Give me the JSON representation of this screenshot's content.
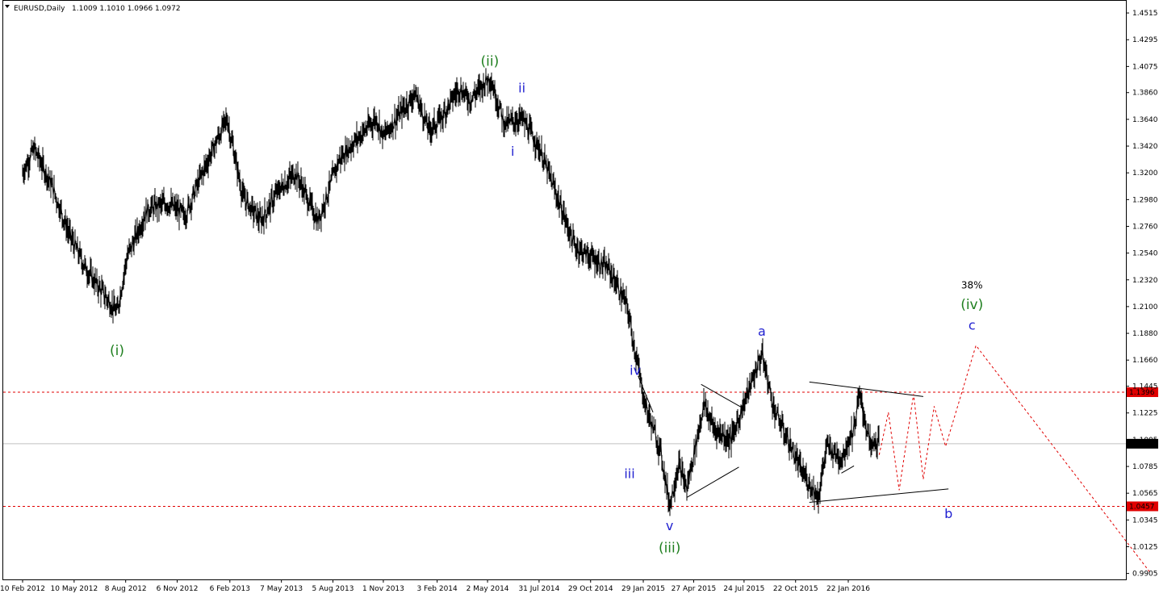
{
  "header": {
    "symbol": "EURUSD,Daily",
    "ohlc": "1.1009 1.1010 1.0966 1.0972"
  },
  "colors": {
    "wave_major": "#1f7f1f",
    "wave_minor": "#1f1fd0",
    "level_line": "#e00000",
    "level_box": "#e00000",
    "price_line": "#c0c0c0",
    "price_box": "#000000",
    "projection": "#e00000",
    "candles": "#000000",
    "pct_label": "#000000"
  },
  "chart_data": {
    "type": "line",
    "title": "",
    "symbol": "EURUSD",
    "timeframe": "Daily",
    "ylim": [
      0.9856,
      1.4615
    ],
    "y_ticks": [
      "1.4515",
      "1.4295",
      "1.4075",
      "1.3860",
      "1.3640",
      "1.3420",
      "1.3200",
      "1.2980",
      "1.2760",
      "1.2540",
      "1.2320",
      "1.2100",
      "1.1880",
      "1.1660",
      "1.1445",
      "1.1225",
      "1.1005",
      "1.0785",
      "1.0565",
      "1.0345",
      "1.0125",
      "0.9905"
    ],
    "x_ticks": [
      "10 Feb 2012",
      "10 May 2012",
      "8 Aug 2012",
      "6 Nov 2012",
      "6 Feb 2013",
      "7 May 2013",
      "5 Aug 2013",
      "1 Nov 2013",
      "3 Feb 2014",
      "2 May 2014",
      "31 Jul 2014",
      "29 Oct 2014",
      "29 Jan 2015",
      "27 Apr 2015",
      "24 Jul 2015",
      "22 Oct 2015",
      "22 Jan 2016"
    ],
    "price_path": {
      "x": [
        "10 Feb 2012",
        "1 Mar 2012",
        "1 Apr 2012",
        "1 May 2012",
        "1 Jun 2012",
        "24 Jul 2012",
        "10 Aug 2012",
        "15 Sep 2012",
        "20 Oct 2012",
        "20 Nov 2012",
        "20 Dec 2012",
        "1 Feb 2013",
        "1 Mar 2013",
        "1 Apr 2013",
        "1 May 2013",
        "1 Jun 2013",
        "10 Jul 2013",
        "15 Aug 2013",
        "10 Sep 2013",
        "20 Oct 2013",
        "1 Nov 2013",
        "10 Dec 2013",
        "27 Dec 2013",
        "20 Jan 2014",
        "10 Feb 2014",
        "13 Mar 2014",
        "1 Apr 2014",
        "6 May 2014",
        "1 Jun 2014",
        "1 Jul 2014",
        "1 Aug 2014",
        "1 Sep 2014",
        "1 Oct 2014",
        "1 Nov 2014",
        "1 Dec 2014",
        "1 Jan 2015",
        "20 Jan 2015",
        "1 Feb 2015",
        "1 Mar 2015",
        "16 Mar 2015",
        "1 Apr 2015",
        "15 Apr 2015",
        "15 May 2015",
        "1 Jun 2015",
        "1 Jul 2015",
        "24 Aug 2015",
        "15 Sep 2015",
        "1 Nov 2015",
        "1 Dec 2015",
        "15 Dec 2015",
        "10 Jan 2016",
        "1 Feb 2016",
        "11 Feb 2016",
        "1 Mar 2016",
        "16 Mar 2016"
      ],
      "y": [
        1.32,
        1.34,
        1.31,
        1.27,
        1.24,
        1.205,
        1.25,
        1.29,
        1.295,
        1.285,
        1.32,
        1.365,
        1.3,
        1.28,
        1.305,
        1.32,
        1.28,
        1.33,
        1.345,
        1.365,
        1.35,
        1.375,
        1.385,
        1.355,
        1.365,
        1.39,
        1.38,
        1.399,
        1.36,
        1.365,
        1.34,
        1.3,
        1.26,
        1.25,
        1.24,
        1.21,
        1.16,
        1.13,
        1.09,
        1.047,
        1.08,
        1.06,
        1.13,
        1.11,
        1.1,
        1.171,
        1.125,
        1.075,
        1.053,
        1.095,
        1.085,
        1.11,
        1.1376,
        1.095,
        1.1
      ]
    },
    "levels": [
      {
        "value": 1.1396,
        "label": "1.1396"
      },
      {
        "value": 1.0457,
        "label": "1.0457"
      }
    ],
    "current_price": {
      "value": 1.0972,
      "label": "1.0972"
    },
    "wave_labels": [
      {
        "text": "(i)",
        "date": "24 Jul 2012",
        "price": 1.17,
        "degree": "major"
      },
      {
        "text": "(ii)",
        "date": "6 May 2014",
        "price": 1.408,
        "degree": "major"
      },
      {
        "text": "i",
        "date": "15 Jun 2014",
        "price": 1.334,
        "degree": "minor"
      },
      {
        "text": "ii",
        "date": "1 Jul 2014",
        "price": 1.386,
        "degree": "minor"
      },
      {
        "text": "iii",
        "date": "5 Jan 2015",
        "price": 1.069,
        "degree": "minor"
      },
      {
        "text": "iv",
        "date": "15 Jan 2015",
        "price": 1.154,
        "degree": "minor"
      },
      {
        "text": "v",
        "date": "16 Mar 2015",
        "price": 1.026,
        "degree": "minor"
      },
      {
        "text": "(iii)",
        "date": "16 Mar 2015",
        "price": 1.008,
        "degree": "major"
      },
      {
        "text": "a",
        "date": "24 Aug 2015",
        "price": 1.186,
        "degree": "minor"
      },
      {
        "text": "b",
        "date": "15 Jul 2016",
        "price": 1.036,
        "degree": "minor"
      },
      {
        "text": "c",
        "date": "25 Aug 2016",
        "price": 1.191,
        "degree": "minor"
      },
      {
        "text": "(iv)",
        "date": "25 Aug 2016",
        "price": 1.208,
        "degree": "major"
      },
      {
        "text": "38%",
        "date": "25 Aug 2016",
        "price": 1.225,
        "degree": "pct"
      }
    ],
    "triangle_lines": [
      {
        "from": {
          "date": "20 Jan 2015",
          "price": 1.153
        },
        "to": {
          "date": "15 Feb 2015",
          "price": 1.123
        }
      },
      {
        "from": {
          "date": "15 Apr 2015",
          "price": 1.053
        },
        "to": {
          "date": "15 Jul 2015",
          "price": 1.078
        }
      },
      {
        "from": {
          "date": "10 May 2015",
          "price": 1.146
        },
        "to": {
          "date": "20 Jul 2015",
          "price": 1.127
        }
      },
      {
        "from": {
          "date": "15 Nov 2015",
          "price": 1.148
        },
        "to": {
          "date": "1 Jun 2016",
          "price": 1.136
        }
      },
      {
        "from": {
          "date": "15 Nov 2015",
          "price": 1.049
        },
        "to": {
          "date": "15 Jul 2016",
          "price": 1.06
        }
      },
      {
        "from": {
          "date": "10 Jan 2016",
          "price": 1.073
        },
        "to": {
          "date": "1 Feb 2016",
          "price": 1.079
        }
      }
    ],
    "projection": {
      "x": [
        "16 Mar 2016",
        "1 Apr 2016",
        "20 Apr 2016",
        "15 May 2016",
        "1 Jun 2016",
        "20 Jun 2016",
        "10 Jul 2016",
        "1 Sep 2016",
        "1 Jul 2017"
      ],
      "y": [
        1.088,
        1.123,
        1.059,
        1.138,
        1.068,
        1.128,
        1.095,
        1.178,
        0.992
      ]
    }
  }
}
